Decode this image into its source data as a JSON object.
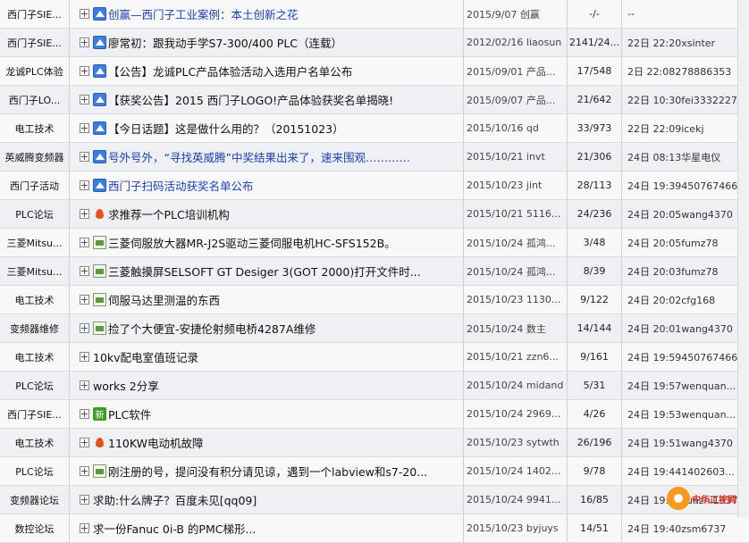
{
  "rows": [
    {
      "forum": "西门子SIE...",
      "icon": "pin",
      "title": "创赢—西门子工业案例：本土创新之花",
      "color": "blue",
      "date": "2015/9/07",
      "author": "创赢",
      "stats": "-/-",
      "last_time": "--",
      "last_user": ""
    },
    {
      "forum": "西门子SIE...",
      "icon": "pin",
      "title": "廖常初：跟我动手学S7-300/400 PLC（连载）",
      "color": "dark",
      "date": "2012/02/16",
      "author": "liaosun",
      "stats": "2141/24...",
      "last_time": "22日 22:20",
      "last_user": "xsinter"
    },
    {
      "forum": "龙诚PLC体验",
      "icon": "pin",
      "title": "【公告】龙诚PLC产品体验活动入选用户名单公布",
      "color": "dark",
      "date": "2015/09/01",
      "author": "产品...",
      "stats": "17/548",
      "last_time": "2日 22:08",
      "last_user": "278886353"
    },
    {
      "forum": "西门子LO...",
      "icon": "pin",
      "title": "【获奖公告】2015 西门子LOGO!产品体验获奖名单揭晓!",
      "color": "dark",
      "date": "2015/09/07",
      "author": "产品...",
      "stats": "21/642",
      "last_time": "22日 10:30",
      "last_user": "fei3332227"
    },
    {
      "forum": "电工技术",
      "icon": "pin",
      "title": "【今日话题】这是做什么用的？（20151023）",
      "color": "dark",
      "date": "2015/10/16",
      "author": "qd",
      "stats": "33/973",
      "last_time": "22日 22:09",
      "last_user": "icekj"
    },
    {
      "forum": "英威腾变频器",
      "icon": "pin",
      "title": "号外号外，“寻找英威腾”中奖结果出来了，速来围观…………",
      "color": "blue",
      "date": "2015/10/21",
      "author": "invt",
      "stats": "21/306",
      "last_time": "24日 08:13",
      "last_user": "华星电仪"
    },
    {
      "forum": "西门子活动",
      "icon": "pin",
      "title": "西门子扫码活动获奖名单公布",
      "color": "blue",
      "date": "2015/10/23",
      "author": "jint",
      "stats": "28/113",
      "last_time": "24日 19:39",
      "last_user": "450767466"
    },
    {
      "forum": "PLC论坛",
      "icon": "hot",
      "title": "求推荐一个PLC培训机构",
      "color": "dark",
      "date": "2015/10/21",
      "author": "5116...",
      "stats": "24/236",
      "last_time": "24日 20:05",
      "last_user": "wang4370"
    },
    {
      "forum": "三菱Mitsu...",
      "icon": "img",
      "title": "三菱伺服放大器MR-J2S驱动三菱伺服电机HC-SFS152B。",
      "color": "dark",
      "date": "2015/10/24",
      "author": "孤鸿...",
      "stats": "3/48",
      "last_time": "24日 20:05",
      "last_user": "fumz78"
    },
    {
      "forum": "三菱Mitsu...",
      "icon": "img",
      "title": "三菱触摸屏SELSOFT GT Desiger 3(GOT 2000)打开文件时...",
      "color": "dark",
      "date": "2015/10/24",
      "author": "孤鸿...",
      "stats": "8/39",
      "last_time": "24日 20:03",
      "last_user": "fumz78"
    },
    {
      "forum": "电工技术",
      "icon": "img",
      "title": "伺服马达里测温的东西",
      "color": "dark",
      "date": "2015/10/23",
      "author": "1130...",
      "stats": "9/122",
      "last_time": "24日 20:02",
      "last_user": "cfg168"
    },
    {
      "forum": "变频器维修",
      "icon": "img",
      "title": "捡了个大便宜-安捷伦射频电桥4287A维修",
      "color": "dark",
      "date": "2015/10/24",
      "author": "数主",
      "stats": "14/144",
      "last_time": "24日 20:01",
      "last_user": "wang4370"
    },
    {
      "forum": "电工技术",
      "icon": "none",
      "title": "10kv配电室值班记录",
      "color": "dark",
      "date": "2015/10/21",
      "author": "zzn6...",
      "stats": "9/161",
      "last_time": "24日 19:59",
      "last_user": "450767466"
    },
    {
      "forum": "PLC论坛",
      "icon": "none",
      "title": "works 2分享",
      "color": "dark",
      "date": "2015/10/24",
      "author": "midand",
      "stats": "5/31",
      "last_time": "24日 19:57",
      "last_user": "wenquan..."
    },
    {
      "forum": "西门子SIE...",
      "icon": "new",
      "title": "PLC软件",
      "color": "dark",
      "date": "2015/10/24",
      "author": "2969...",
      "stats": "4/26",
      "last_time": "24日 19:53",
      "last_user": "wenquan..."
    },
    {
      "forum": "电工技术",
      "icon": "hot",
      "title": "110KW电动机故障",
      "color": "dark",
      "date": "2015/10/23",
      "author": "sytwth",
      "stats": "26/196",
      "last_time": "24日 19:51",
      "last_user": "wang4370"
    },
    {
      "forum": "PLC论坛",
      "icon": "img",
      "title": "刚注册的号，提问没有积分请见谅，遇到一个labview和s7-20...",
      "color": "dark",
      "date": "2015/10/24",
      "author": "1402...",
      "stats": "9/78",
      "last_time": "24日 19:44",
      "last_user": "1402603..."
    },
    {
      "forum": "变频器论坛",
      "icon": "none",
      "title": "求助:什么牌子？百度未见[qq09]",
      "color": "dark",
      "date": "2015/10/24",
      "author": "9941...",
      "stats": "16/85",
      "last_time": "24日 19:43",
      "last_user": "sunzhi1937"
    },
    {
      "forum": "数控论坛",
      "icon": "none",
      "title": "求一份Fanuc 0i-B 的PMC梯形...",
      "color": "dark",
      "date": "2015/10/23",
      "author": "byjuys",
      "stats": "14/51",
      "last_time": "24日 19:40",
      "last_user": "zsm6737"
    }
  ],
  "watermark": {
    "text": "中华工控网"
  },
  "colors": {
    "title_blue": "#1a3fb5",
    "pin_icon": "#3d7ee0",
    "row_alt": "#eef0f3"
  }
}
